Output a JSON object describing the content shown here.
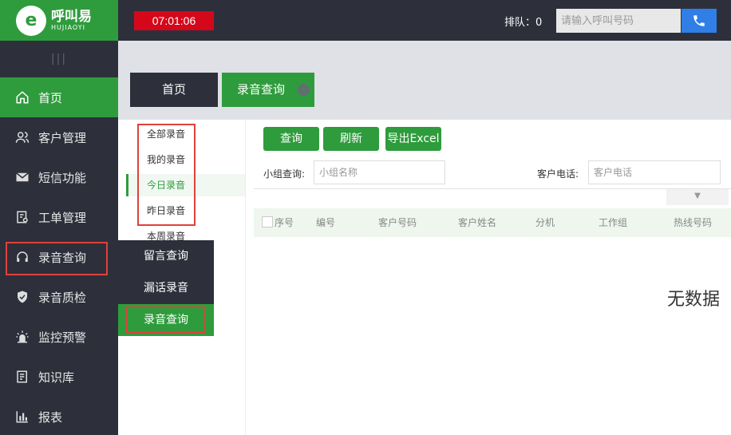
{
  "logo": {
    "mark": "e",
    "cn": "呼叫易",
    "en": "HUJIAOYI"
  },
  "topbar": {
    "timer": "07:01:06",
    "queue": "排队：0",
    "call_placeholder": "请输入呼叫号码",
    "call_icon": "phone-icon"
  },
  "sidebar": {
    "grip": "|||",
    "items": [
      {
        "label": "首页",
        "icon": "home-icon"
      },
      {
        "label": "客户管理",
        "icon": "users-icon"
      },
      {
        "label": "短信功能",
        "icon": "mail-icon"
      },
      {
        "label": "工单管理",
        "icon": "ticket-icon"
      },
      {
        "label": "录音查询",
        "icon": "headset-icon"
      },
      {
        "label": "录音质检",
        "icon": "shield-check-icon"
      },
      {
        "label": "监控预警",
        "icon": "alarm-icon"
      },
      {
        "label": "知识库",
        "icon": "book-icon"
      },
      {
        "label": "报表",
        "icon": "bar-chart-icon"
      }
    ]
  },
  "flyout": {
    "items": [
      "留言查询",
      "漏话录音",
      "录音查询"
    ]
  },
  "tabs": {
    "home": "首页",
    "records": "录音查询",
    "close": "×"
  },
  "sublist": {
    "items": [
      "全部录音",
      "我的录音",
      "今日录音",
      "昨日录音",
      "本周录音"
    ]
  },
  "toolbar": {
    "query": "查询",
    "refresh": "刷新",
    "export": "导出Excel"
  },
  "filters": {
    "group_label": "小组查询:",
    "group_placeholder": "小组名称",
    "phone_label": "客户电话:",
    "phone_placeholder": "客户电话",
    "collapse": "▼"
  },
  "table": {
    "headers": [
      "序号",
      "编号",
      "客户号码",
      "客户姓名",
      "分机",
      "工作组",
      "热线号码"
    ],
    "empty": "无数据"
  },
  "colors": {
    "green": "#2e9c3c",
    "dark": "#2d303b",
    "red": "#d4081a",
    "blue": "#2f7fe6",
    "highlight": "#e0413a"
  }
}
